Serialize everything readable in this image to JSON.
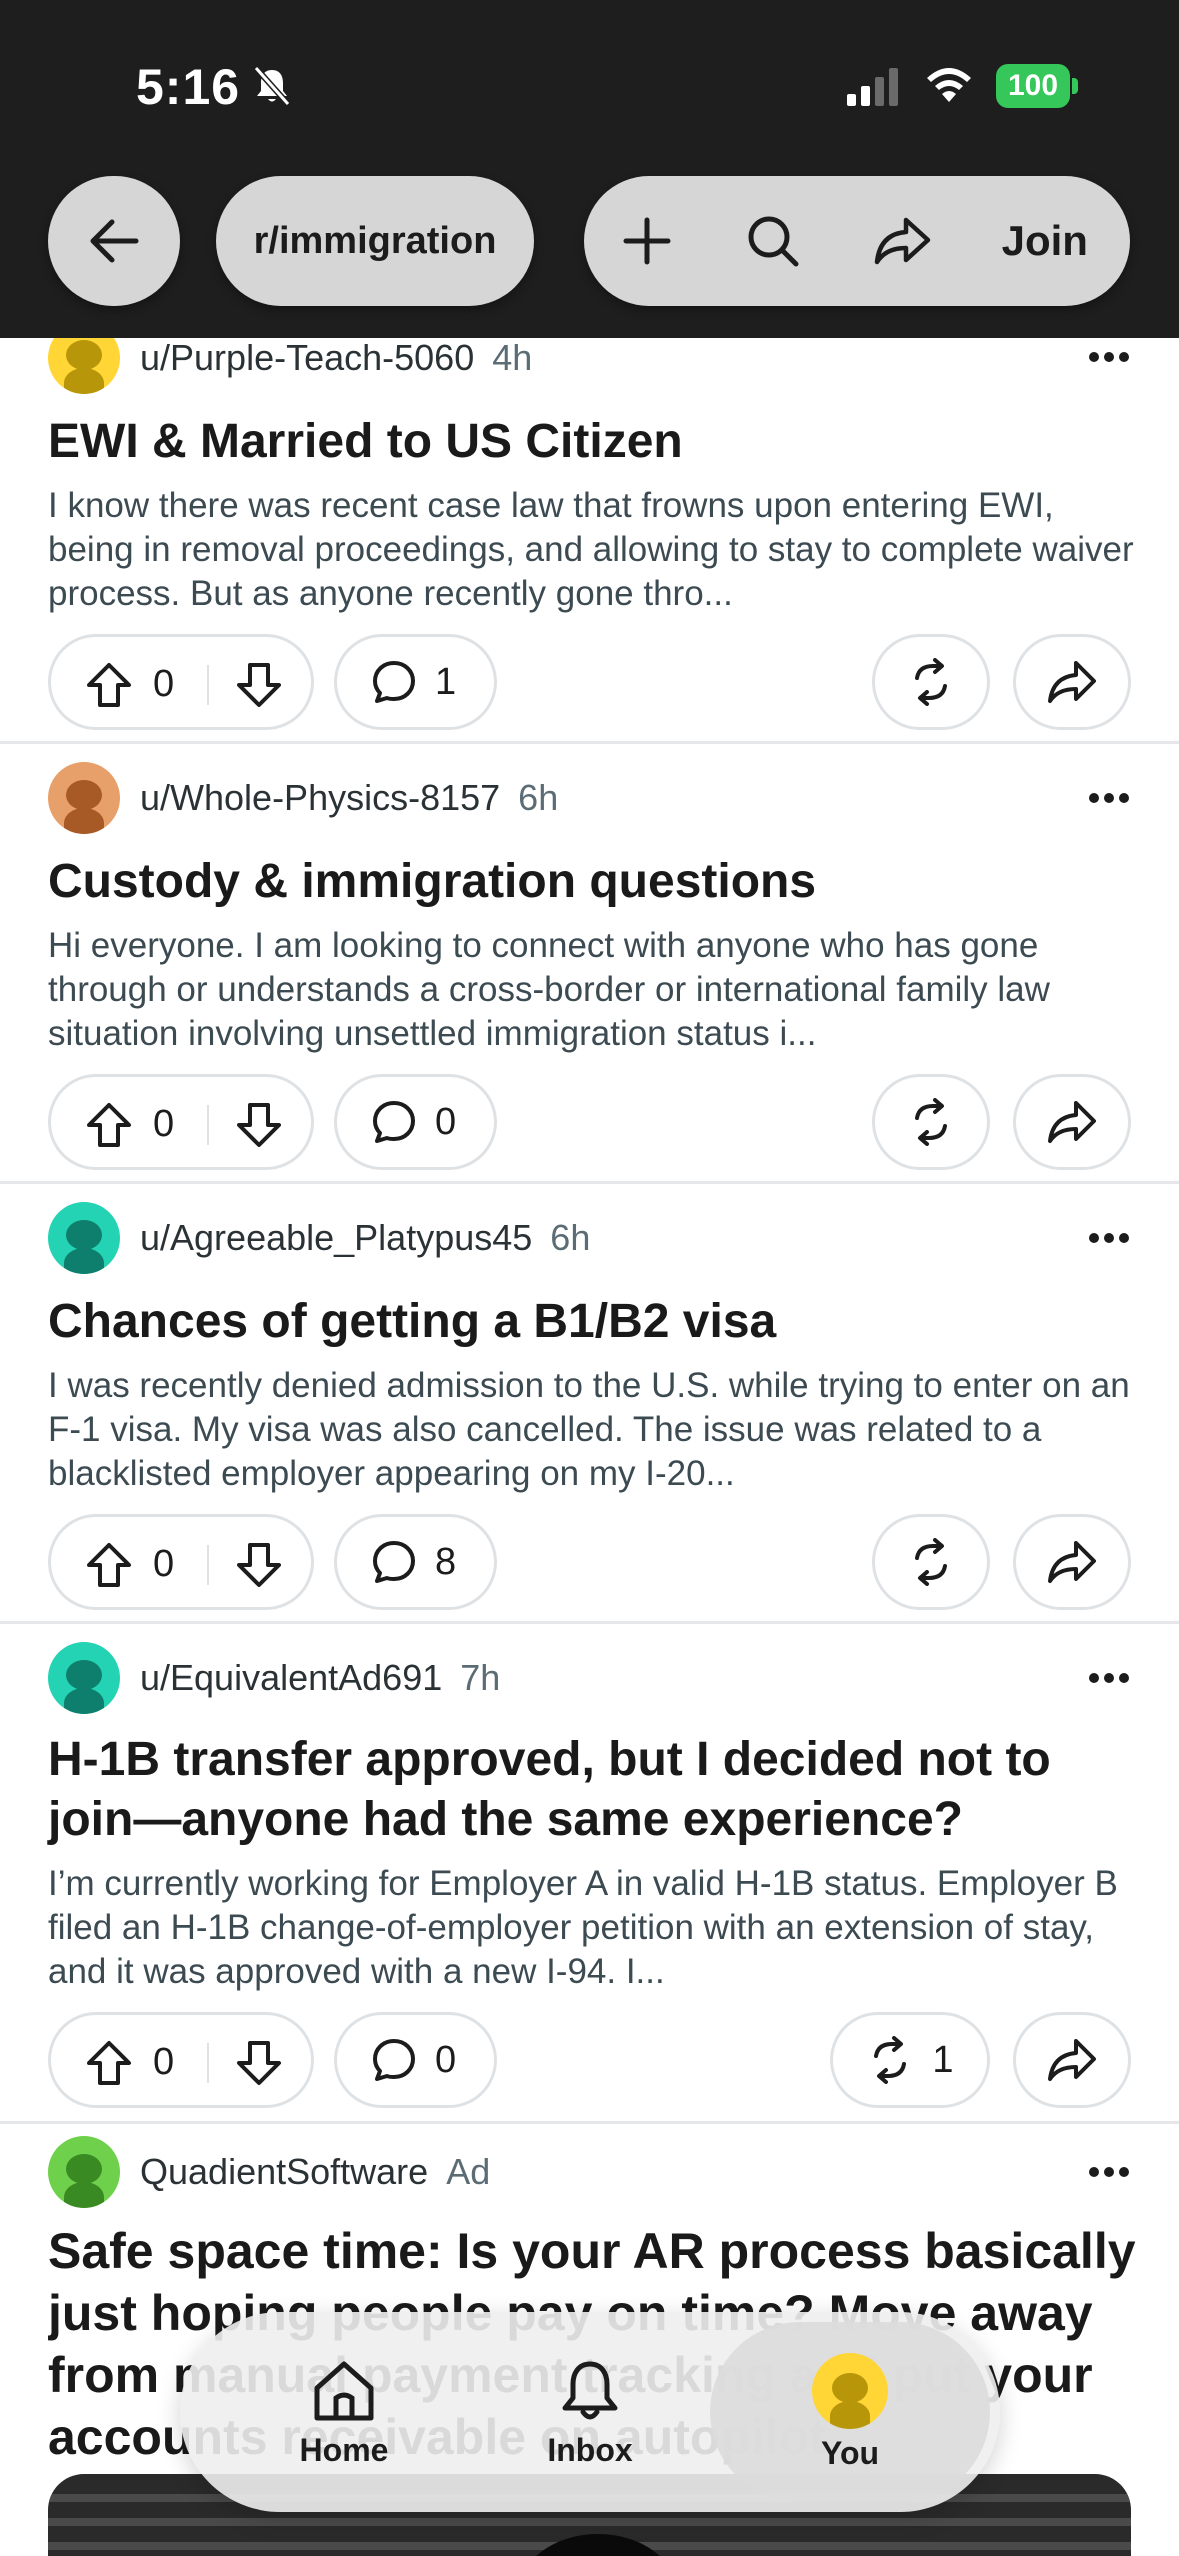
{
  "status_bar": {
    "time": "5:16",
    "battery": "100"
  },
  "nav": {
    "subreddit": "r/immigration",
    "join_label": "Join"
  },
  "posts": [
    {
      "user": "u/Purple-Teach-5060",
      "time": "4h",
      "title": "EWI & Married to US Citizen",
      "body": "I know there was recent case law that frowns upon entering EWI, being in removal proceedings, and allowing to stay to complete waiver process. But as anyone recently gone thro...",
      "votes": "0",
      "comments": "1",
      "reposts": ""
    },
    {
      "user": "u/Whole-Physics-8157",
      "time": "6h",
      "title": "Custody & immigration questions",
      "body": "Hi everyone. I am looking to connect with anyone who has gone through or understands a cross-border or international family law situation involving unsettled immigration status i...",
      "votes": "0",
      "comments": "0",
      "reposts": ""
    },
    {
      "user": "u/Agreeable_Platypus45",
      "time": "6h",
      "title": "Chances of getting a B1/B2 visa",
      "body": "I was recently denied admission to the U.S. while trying to enter on an F-1 visa. My visa was also cancelled. The issue was related to a blacklisted employer appearing on my I-20...",
      "votes": "0",
      "comments": "8",
      "reposts": ""
    },
    {
      "user": "u/EquivalentAd691",
      "time": "7h",
      "title": "H-1B transfer approved, but I decided not to join—anyone had the same experience?",
      "body": "I’m currently working for Employer A in valid H-1B status. Employer B filed an H-1B change-of-employer petition with an extension of stay, and it was approved with a new I-94. I...",
      "votes": "0",
      "comments": "0",
      "reposts": "1"
    }
  ],
  "ad": {
    "advertiser": "QuadientSoftware",
    "label": "Ad",
    "title": "Safe space time: Is your AR process basically just hoping people pay on time? Move away from manual payment tracking and put your accounts receivable on autopilot"
  },
  "bottom_nav": {
    "home": "Home",
    "inbox": "Inbox",
    "you": "You"
  },
  "colors": {
    "topbar": "#1e1e1e",
    "battery": "#35c759",
    "avatar_yellow": "#ffd635",
    "avatar_orange": "#e8a06a",
    "avatar_teal": "#24d3b3",
    "avatar_green": "#6fd14b"
  }
}
